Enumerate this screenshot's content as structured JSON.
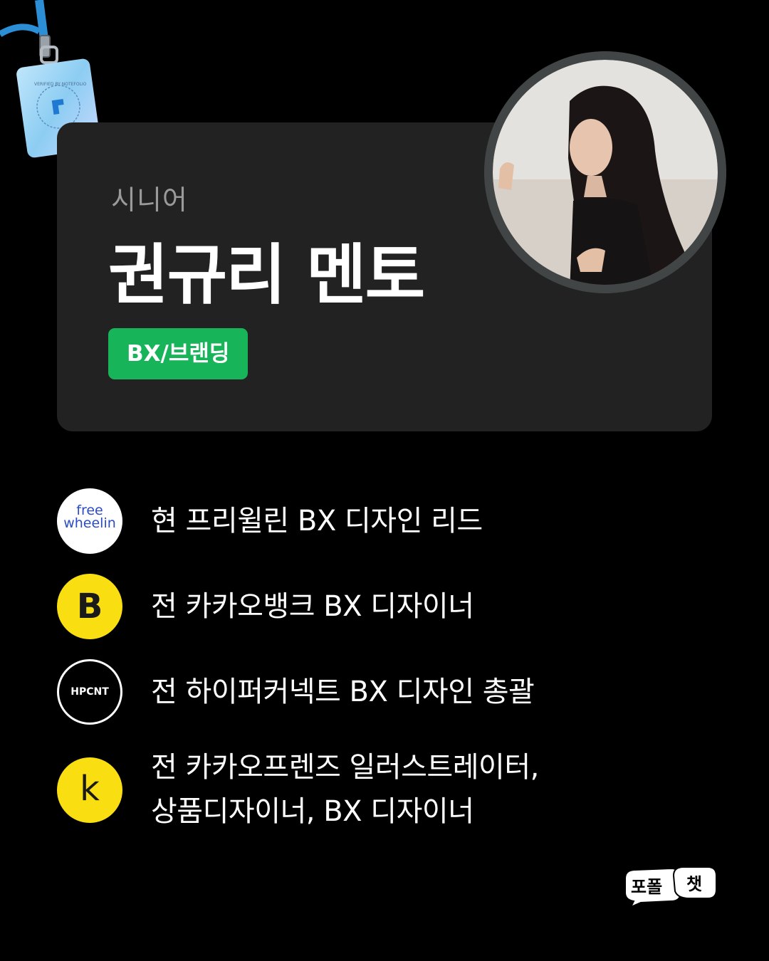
{
  "badge": {
    "label": "VERIFIED BY NOTEFOLIO"
  },
  "mentor": {
    "level": "시니어",
    "name": "권규리 멘토",
    "category_tag": "BX/브랜딩",
    "tag_color": "#17b45a"
  },
  "career": [
    {
      "logo_icon": "freewheelin-logo-icon",
      "logo_text_1": "free",
      "logo_text_2": "wheelin",
      "text_1": "현 프리윌린 BX 디자인 리드",
      "text_2": ""
    },
    {
      "logo_icon": "kakaobank-logo-icon",
      "logo_text_1": "B",
      "text_1": "전 카카오뱅크 BX 디자이너",
      "text_2": ""
    },
    {
      "logo_icon": "hpcnt-logo-icon",
      "logo_text_1": "HPCNT",
      "text_1": "전 하이퍼커넥트 BX 디자인 총괄",
      "text_2": ""
    },
    {
      "logo_icon": "kakaofriends-logo-icon",
      "logo_text_1": "k",
      "text_1": "전 카카오프렌즈 일러스트레이터,",
      "text_2": "상품디자이너, BX 디자이너"
    }
  ],
  "brand": {
    "text_1": "포폴",
    "text_2": "챗"
  },
  "colors": {
    "background": "#000000",
    "card": "#222222",
    "kakao_yellow": "#f9de11"
  }
}
